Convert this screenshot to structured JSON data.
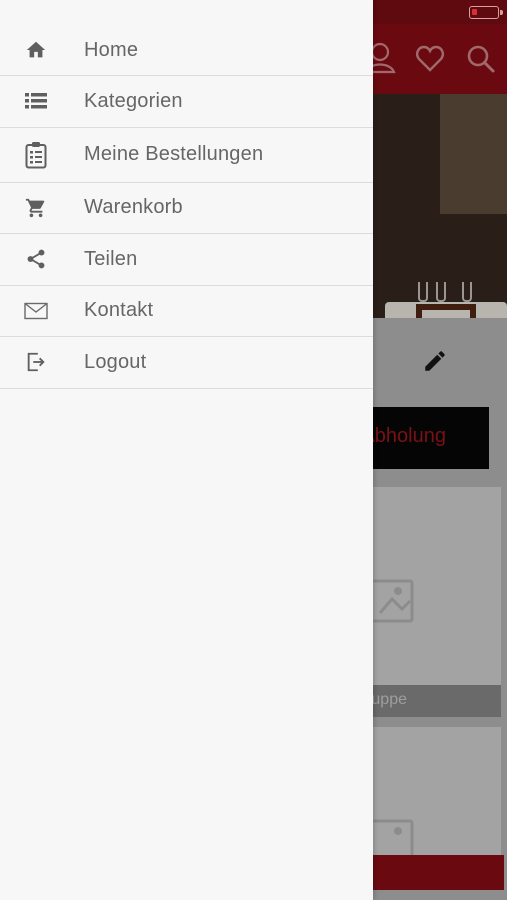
{
  "colors": {
    "brand": "#8b0d14",
    "drawer_bg": "#f7f7f7",
    "menu_text": "#666666",
    "icon": "#5f5f5f"
  },
  "background": {
    "header_icons": [
      "user-icon",
      "heart-icon",
      "search-icon"
    ],
    "pickup_button_label": "Abholung",
    "card_label": "Suppe",
    "edit_icon": "pencil-icon",
    "battery_icon": "battery-low-icon"
  },
  "menu": {
    "items": [
      {
        "label": "Home",
        "icon": "home-icon"
      },
      {
        "label": "Kategorien",
        "icon": "list-icon"
      },
      {
        "label": "Meine Bestellungen",
        "icon": "clipboard-icon"
      },
      {
        "label": "Warenkorb",
        "icon": "cart-icon"
      },
      {
        "label": "Teilen",
        "icon": "share-icon"
      },
      {
        "label": "Kontakt",
        "icon": "mail-icon"
      },
      {
        "label": "Logout",
        "icon": "logout-icon"
      }
    ]
  }
}
